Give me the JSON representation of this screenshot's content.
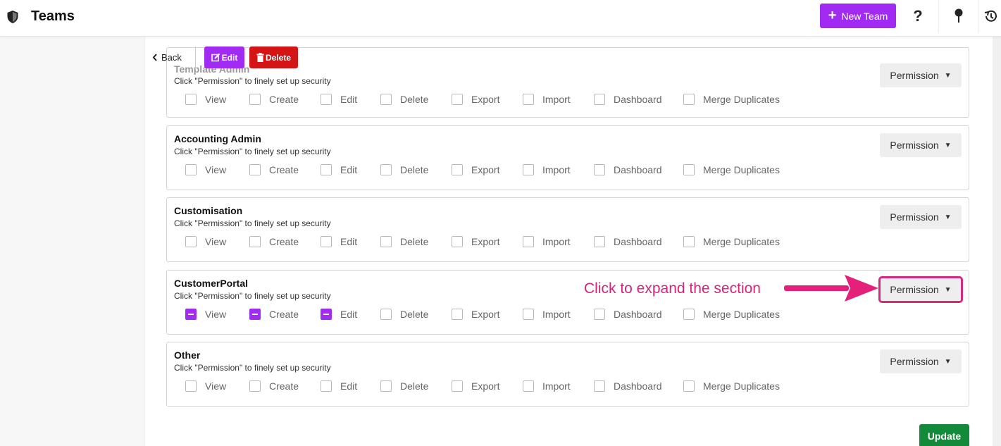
{
  "header": {
    "title": "Teams",
    "new_team_label": "New Team",
    "help_glyph": "?"
  },
  "toolbar": {
    "back_label": "Back",
    "edit_label": "Edit",
    "delete_label": "Delete"
  },
  "permission_labels": [
    "View",
    "Create",
    "Edit",
    "Delete",
    "Export",
    "Import",
    "Dashboard",
    "Merge Duplicates"
  ],
  "sections": [
    {
      "name": "Template Admin",
      "hint": "Click \"Permission\" to finely set up security",
      "button": "Permission",
      "checked": [
        false,
        false,
        false,
        false,
        false,
        false,
        false,
        false
      ]
    },
    {
      "name": "Accounting Admin",
      "hint": "Click \"Permission\" to finely set up security",
      "button": "Permission",
      "checked": [
        false,
        false,
        false,
        false,
        false,
        false,
        false,
        false
      ]
    },
    {
      "name": "Customisation",
      "hint": "Click \"Permission\" to finely set up security",
      "button": "Permission",
      "checked": [
        false,
        false,
        false,
        false,
        false,
        false,
        false,
        false
      ]
    },
    {
      "name": "CustomerPortal",
      "hint": "Click \"Permission\" to finely set up security",
      "button": "Permission",
      "checked": [
        true,
        true,
        true,
        false,
        false,
        false,
        false,
        false
      ]
    },
    {
      "name": "Other",
      "hint": "Click \"Permission\" to finely set up security",
      "button": "Permission",
      "checked": [
        false,
        false,
        false,
        false,
        false,
        false,
        false,
        false
      ]
    }
  ],
  "annotation": {
    "text": "Click to expand the section",
    "color": "#d8237b"
  },
  "update_label": "Update",
  "colors": {
    "accent": "#a12bf2",
    "danger": "#d31515",
    "success": "#138a3a"
  }
}
